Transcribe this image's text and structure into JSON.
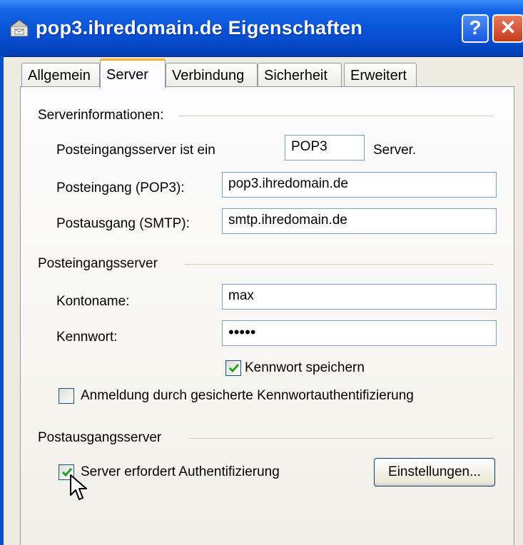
{
  "window": {
    "title": "pop3.ihredomain.de Eigenschaften",
    "help_label": "?",
    "close_label": "✕"
  },
  "tabs": [
    {
      "label": "Allgemein",
      "active": false
    },
    {
      "label": "Server",
      "active": true
    },
    {
      "label": "Verbindung",
      "active": false
    },
    {
      "label": "Sicherheit",
      "active": false
    },
    {
      "label": "Erweitert",
      "active": false
    }
  ],
  "server_info": {
    "group_title": "Serverinformationen:",
    "incoming_type_label": "Posteingangsserver ist ein",
    "incoming_type_value": "POP3",
    "incoming_type_suffix": "Server.",
    "incoming_label": "Posteingang (POP3):",
    "incoming_value": "pop3.ihredomain.de",
    "outgoing_label": "Postausgang (SMTP):",
    "outgoing_value": "smtp.ihredomain.de"
  },
  "incoming_server": {
    "group_title": "Posteingangsserver",
    "account_label": "Kontoname:",
    "account_value": "max",
    "password_label": "Kennwort:",
    "password_value": "•••••",
    "remember_password_label": "Kennwort speichern",
    "remember_password_checked": true,
    "spa_label": "Anmeldung durch gesicherte Kennwortauthentifizierung",
    "spa_checked": false
  },
  "outgoing_server": {
    "group_title": "Postausgangsserver",
    "auth_required_label": "Server erfordert Authentifizierung",
    "auth_required_checked": true,
    "settings_button_label": "Einstellungen..."
  },
  "colors": {
    "titlebar": "#0a55d8",
    "active_tab_accent": "#f8b334",
    "checkmark": "#21a121"
  },
  "icons": [
    "mail-server-icon",
    "help-icon",
    "close-icon",
    "checkmark-icon",
    "mouse-pointer-icon"
  ]
}
